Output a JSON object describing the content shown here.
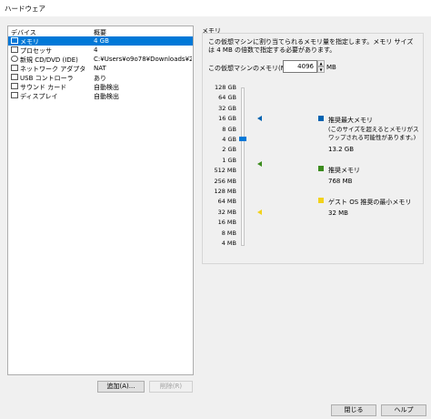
{
  "window": {
    "title": "ハードウェア"
  },
  "device_list": {
    "headers": {
      "device": "デバイス",
      "summary": "概要"
    },
    "rows": [
      {
        "name": "メモリ",
        "value": "4 GB",
        "icon": "memory-icon",
        "selected": true
      },
      {
        "name": "プロセッサ",
        "value": "4",
        "icon": "processor-icon"
      },
      {
        "name": "新規 CD/DVD (IDE)",
        "value": "C:¥Users¥o9o78¥Downloads¥20...",
        "icon": "cd-dvd-icon"
      },
      {
        "name": "ネットワーク アダプタ",
        "value": "NAT",
        "icon": "network-adapter-icon"
      },
      {
        "name": "USB コントローラ",
        "value": "あり",
        "icon": "usb-icon"
      },
      {
        "name": "サウンド カード",
        "value": "自動検出",
        "icon": "sound-card-icon"
      },
      {
        "name": "ディスプレイ",
        "value": "自動検出",
        "icon": "display-icon"
      }
    ],
    "add_button": "追加(A)...",
    "remove_button": "削除(R)"
  },
  "memory": {
    "group_title": "メモリ",
    "description": "この仮想マシンに割り当てられるメモリ量を指定します。メモリ サイズは 4 MB の倍数で指定する必要があります。",
    "field_label": "この仮想マシンのメモリ(M):",
    "value": "4096",
    "unit": "MB",
    "scale": [
      "128 GB",
      "64 GB",
      "32 GB",
      "16 GB",
      "8 GB",
      "4 GB",
      "2 GB",
      "1 GB",
      "512 MB",
      "256 MB",
      "128 MB",
      "64 MB",
      "32 MB",
      "16 MB",
      "8 MB",
      "4 MB"
    ],
    "current_level": "4 GB",
    "legend": [
      {
        "title": "推奨最大メモリ",
        "note": "(このサイズを超えるとメモリがスワップされる可能性があります。)",
        "value": "13.2 GB",
        "color": "#0063b1",
        "level": "16 GB"
      },
      {
        "title": "推奨メモリ",
        "note": "",
        "value": "768 MB",
        "color": "#3c8c1e",
        "level": "1 GB"
      },
      {
        "title": "ゲスト OS 推奨の最小メモリ",
        "note": "",
        "value": "32 MB",
        "color": "#f2d21b",
        "level": "32 MB"
      }
    ]
  },
  "footer": {
    "close_button": "閉じる",
    "help_button": "ヘルプ"
  }
}
